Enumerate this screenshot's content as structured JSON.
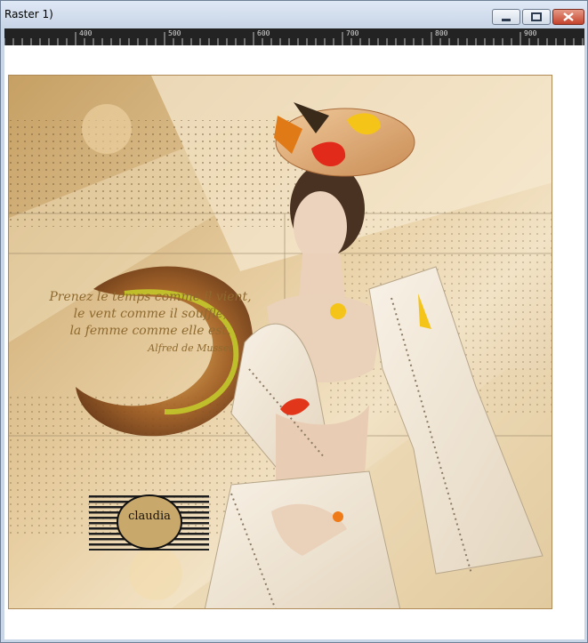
{
  "window": {
    "title": "Raster 1)",
    "buttons": {
      "minimize": "minimize-icon",
      "maximize": "maximize-icon",
      "close": "close-icon"
    }
  },
  "ruler": {
    "labels": [
      "400",
      "500",
      "600",
      "700",
      "800",
      "900"
    ]
  },
  "artwork": {
    "quote_lines": [
      "Prenez le temps comme il vient,",
      "le vent comme il souffle,",
      "la femme comme elle est."
    ],
    "quote_author": "Alfred de Musset",
    "signature": "claudia"
  },
  "colors": {
    "titlebar": "#c8d5e7",
    "ruler": "#232323",
    "canvas": "#ffffff",
    "close": "#c4432c"
  }
}
